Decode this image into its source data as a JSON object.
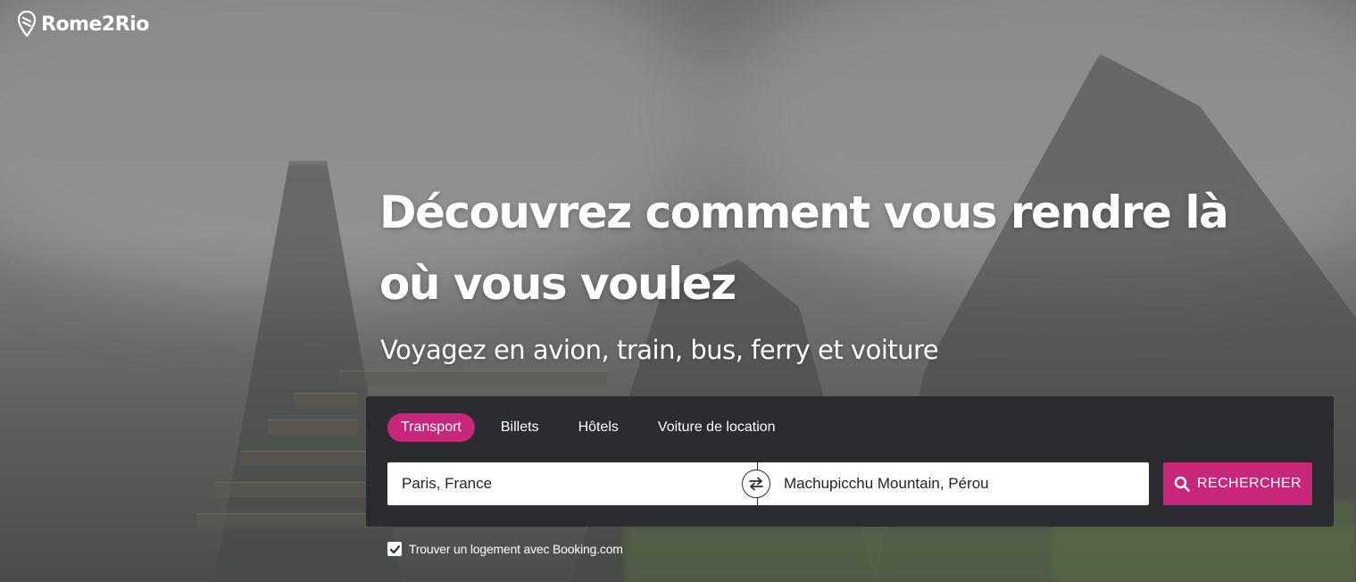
{
  "brand": {
    "name": "Rome2Rio"
  },
  "hero": {
    "headline": "Découvrez comment vous rendre là où vous voulez",
    "subhead": "Voyagez en avion, train, bus, ferry et voiture"
  },
  "search": {
    "tabs": [
      {
        "label": "Transport",
        "active": true
      },
      {
        "label": "Billets",
        "active": false
      },
      {
        "label": "Hôtels",
        "active": false
      },
      {
        "label": "Voiture de location",
        "active": false
      }
    ],
    "from_value": "Paris, France",
    "to_value": "Machupicchu Mountain, Pérou",
    "button_label": "RECHERCHER",
    "swap_icon": "swap-arrows-icon",
    "search_icon": "magnifier-icon"
  },
  "booking": {
    "label": "Trouver un logement avec Booking.com",
    "checked": true
  },
  "colors": {
    "accent": "#c8267a",
    "panel": "#2b2c30",
    "text_light": "#ffffff"
  }
}
